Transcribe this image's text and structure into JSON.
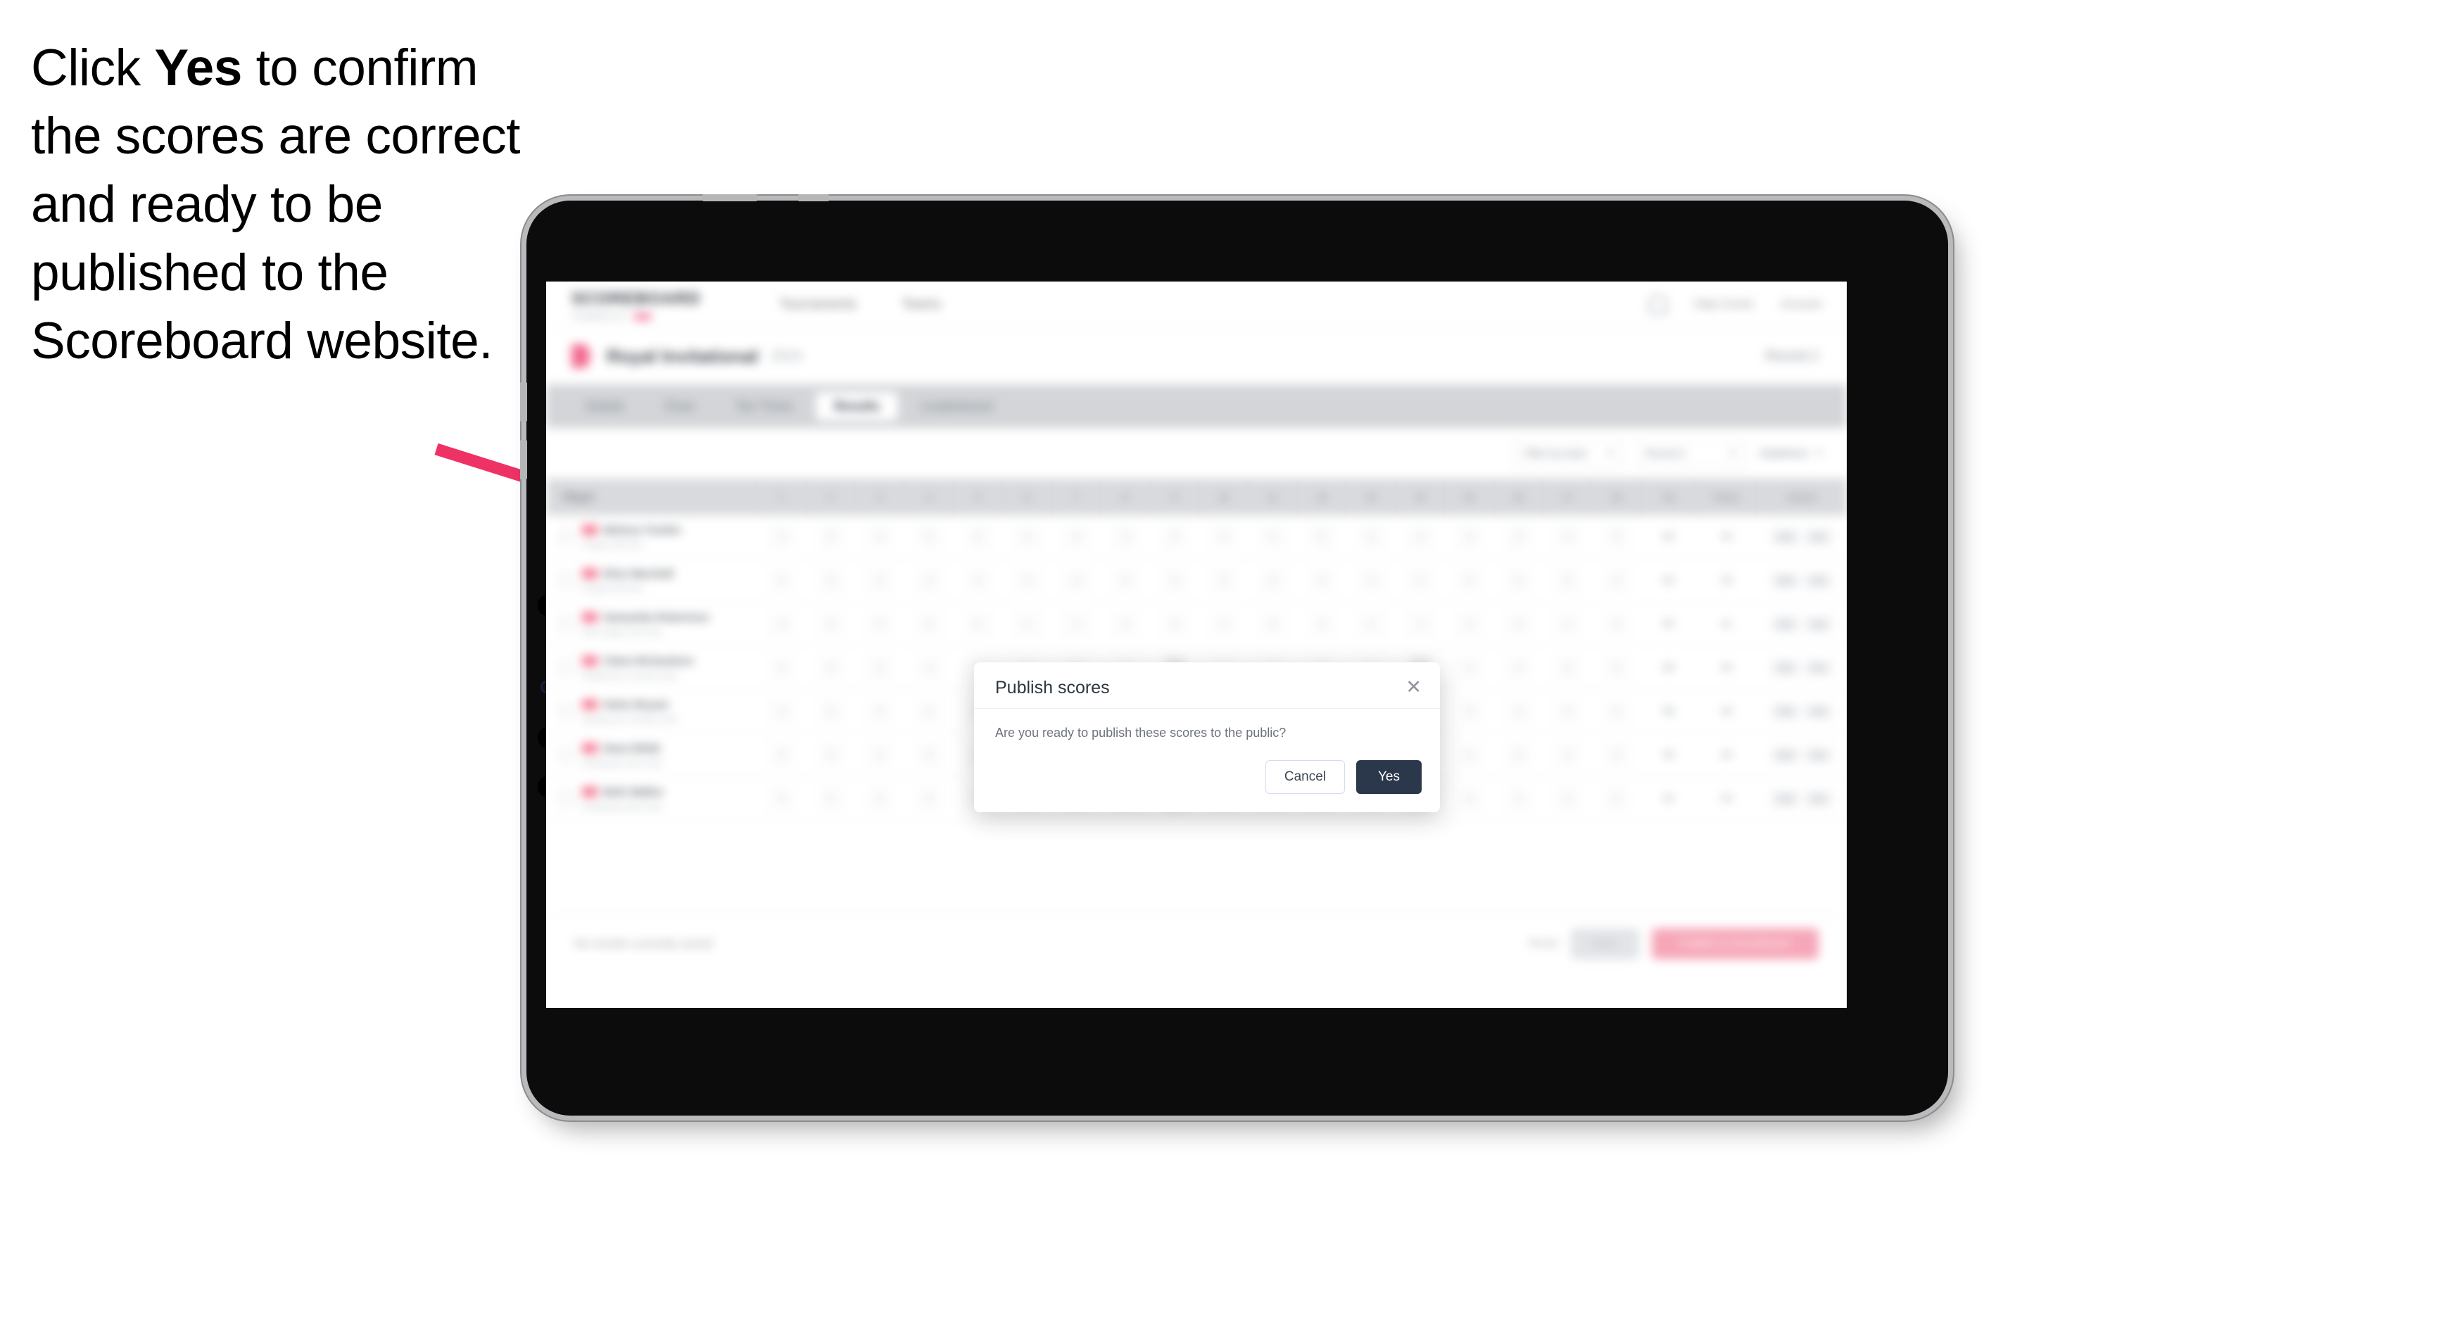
{
  "caption": {
    "part1": "Click ",
    "emphasis": "Yes",
    "part2": " to confirm the scores are correct and ready to be published to the Scoreboard website."
  },
  "annotation": {
    "arrow_color": "#ee3265",
    "arrow_name": "pointer-arrow"
  },
  "device": {
    "type": "tablet",
    "orientation": "landscape",
    "frame_color": "#0c0c0c",
    "bezel_edge_color": "#b9babc"
  },
  "app": {
    "brand": {
      "word": "SCOREBOARD",
      "tagline": "POWERED BY",
      "accent": "#f2678e"
    },
    "nav": [
      {
        "label": "Tournaments",
        "active": false
      },
      {
        "label": "Teams",
        "active": false
      }
    ],
    "topright": [
      {
        "label": "Help Centre"
      },
      {
        "label": "Account"
      }
    ],
    "page": {
      "title": "Royal Invitational",
      "subtitle": "2024",
      "right_label": "Round 2"
    },
    "tabs": [
      {
        "label": "Details",
        "active": false
      },
      {
        "label": "Draw",
        "active": false
      },
      {
        "label": "Tee Times",
        "active": false
      },
      {
        "label": "Results",
        "active": true
      },
      {
        "label": "Leaderboard",
        "active": false
      }
    ],
    "filters": [
      {
        "label": "Filter by team",
        "type": "select"
      },
      {
        "label": "Round 2",
        "type": "select"
      },
      {
        "label": "Stableford",
        "type": "text"
      }
    ],
    "table": {
      "columns": {
        "player": "Player",
        "holes": [
          "1",
          "2",
          "3",
          "4",
          "5",
          "6",
          "7",
          "8",
          "9",
          "10",
          "11",
          "12",
          "13",
          "14",
          "15",
          "16",
          "17",
          "18"
        ],
        "total": "Tot",
        "points": "Points",
        "actions": "Actions"
      },
      "rows": [
        {
          "name": "Melissa Tomkin",
          "club": "Chapel Hill Park",
          "holes": [
            "4",
            "5",
            "4",
            "3",
            "5",
            "4",
            "4",
            "3",
            "5",
            "4",
            "4",
            "5",
            "3",
            "4",
            "4",
            "5",
            "4",
            "3"
          ],
          "total": "80",
          "points": "34",
          "actions": [
            "Edit",
            "Hist"
          ]
        },
        {
          "name": "Elise Marshall",
          "club": "Chapel Hill Park",
          "holes": [
            "5",
            "4",
            "4",
            "4",
            "4",
            "5",
            "3",
            "4",
            "4",
            "5",
            "4",
            "4",
            "4",
            "3",
            "5",
            "4",
            "5",
            "4"
          ],
          "total": "82",
          "points": "33",
          "actions": [
            "Edit",
            "Hist"
          ]
        },
        {
          "name": "Samantha Robertson",
          "club": "Glen Eagle Golf Club",
          "holes": [
            "4",
            "4",
            "5",
            "4",
            "5",
            "4",
            "4",
            "4",
            "5",
            "4",
            "5",
            "4",
            "4",
            "4",
            "4",
            "5",
            "4",
            "4"
          ],
          "total": "84",
          "points": "31",
          "actions": [
            "Edit",
            "Hist"
          ]
        },
        {
          "name": "Claire Richardson",
          "club": "Eastbourne Country Club",
          "holes": [
            "5",
            "5",
            "4",
            "4",
            "5",
            "4",
            "5",
            "4",
            "5",
            "4",
            "4",
            "5",
            "4",
            "5",
            "4",
            "4",
            "5",
            "4"
          ],
          "total": "86",
          "points": "30",
          "actions": [
            "Edit",
            "Hist"
          ]
        },
        {
          "name": "Helen Bryant",
          "club": "Eastbourne Country Club",
          "holes": [
            "4",
            "5",
            "5",
            "4",
            "5",
            "5",
            "4",
            "5",
            "4",
            "5",
            "5",
            "4",
            "5",
            "4",
            "5",
            "4",
            "5",
            "5"
          ],
          "total": "88",
          "points": "28",
          "actions": [
            "Edit",
            "Hist"
          ]
        },
        {
          "name": "Dana Webb",
          "club": "Southward Golf Links",
          "holes": [
            "5",
            "5",
            "4",
            "5",
            "5",
            "4",
            "5",
            "5",
            "5",
            "4",
            "5",
            "5",
            "4",
            "5",
            "5",
            "5",
            "4",
            "5"
          ],
          "total": "90",
          "points": "26",
          "actions": [
            "Edit",
            "Hist"
          ]
        },
        {
          "name": "Beth Walker",
          "club": "Southward Golf Links",
          "holes": [
            "5",
            "5",
            "5",
            "5",
            "4",
            "5",
            "5",
            "5",
            "5",
            "5",
            "4",
            "5",
            "5",
            "5",
            "5",
            "4",
            "5",
            "5"
          ],
          "total": "92",
          "points": "25",
          "actions": [
            "Edit",
            "Hist"
          ]
        }
      ]
    },
    "bottombar": {
      "status": "No results currently saved",
      "link": "Reset",
      "secondary_button": "Save",
      "primary_button": "Publish to Scoreboard"
    }
  },
  "modal": {
    "title": "Publish scores",
    "body": "Are you ready to publish these scores to the public?",
    "close_icon": "✕",
    "cancel_label": "Cancel",
    "confirm_label": "Yes",
    "confirm_bg": "#2b374a"
  }
}
